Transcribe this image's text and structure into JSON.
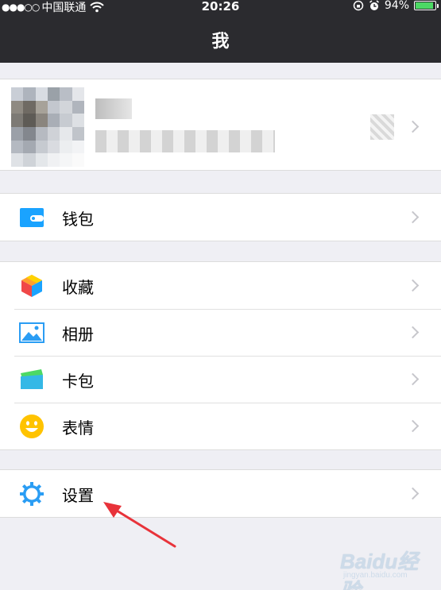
{
  "status_bar": {
    "signal_dots": "●●●○○",
    "carrier": "中国联通",
    "wifi_icon": "wifi-icon",
    "time": "20:26",
    "battery_percent": "94%",
    "battery_level": 0.94
  },
  "header": {
    "title": "我"
  },
  "profile": {
    "avatar_icon": "blurred-avatar",
    "name": "",
    "id": ""
  },
  "groups": [
    {
      "items": [
        {
          "label": "钱包",
          "icon": "wallet-icon",
          "color": "#1aa3ff"
        }
      ]
    },
    {
      "items": [
        {
          "label": "收藏",
          "icon": "favorites-cube-icon",
          "color": "#ffc300"
        },
        {
          "label": "相册",
          "icon": "album-icon",
          "color": "#2a9df4"
        },
        {
          "label": "卡包",
          "icon": "card-package-icon",
          "color": "#34c2d6"
        },
        {
          "label": "表情",
          "icon": "emoji-icon",
          "color": "#ffc300"
        }
      ]
    },
    {
      "items": [
        {
          "label": "设置",
          "icon": "settings-gear-icon",
          "color": "#2a9df4"
        }
      ]
    }
  ],
  "annotation": {
    "arrow_color": "#e8333a"
  },
  "watermark": {
    "brand": "Baidu经验",
    "url": "jingyan.baidu.com"
  }
}
